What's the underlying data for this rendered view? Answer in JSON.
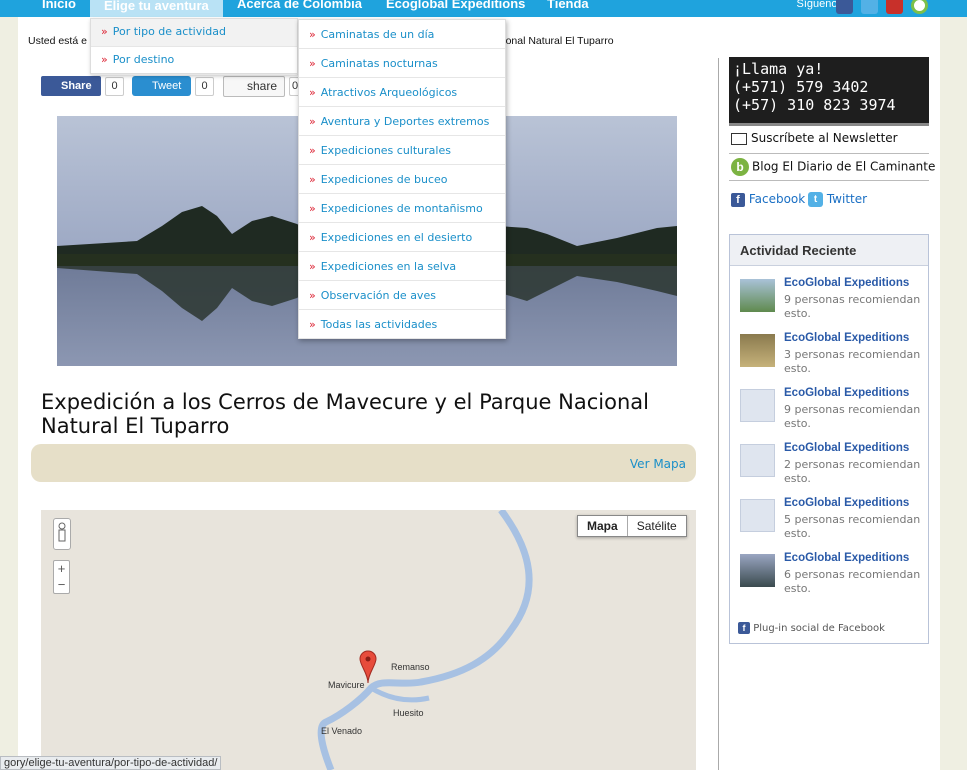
{
  "nav": {
    "items": [
      "Inicio",
      "Elige tu aventura",
      "Acerca de Colombia",
      "Ecoglobal Expeditions",
      "Tienda"
    ],
    "siguenos": "Síguenos"
  },
  "breadcrumb": {
    "start": "Usted está e",
    "end": "cional Natural El Tuparro"
  },
  "submenu1": [
    "Por tipo de actividad",
    "Por destino"
  ],
  "submenu2": [
    "Caminatas de un día",
    "Caminatas nocturnas",
    "Atractivos Arqueológicos",
    "Aventura y Deportes extremos",
    "Expediciones culturales",
    "Expediciones de buceo",
    "Expediciones de montañismo",
    "Expediciones en el desierto",
    "Expediciones en la selva",
    "Observación de aves",
    "Todas las actividades"
  ],
  "share": {
    "fb_label": "Share",
    "fb_count": "0",
    "tweet_label": "Tweet",
    "tweet_count": "0",
    "mail_label": "share",
    "mail_count": "0"
  },
  "page_title": "Expedición a los Cerros de Mavecure y el Parque Nacional Natural El Tuparro",
  "ver_mapa": "Ver Mapa",
  "map": {
    "type_map": "Mapa",
    "type_sat": "Satélite",
    "zoom_in": "+",
    "zoom_out": "−",
    "labels": [
      "Remanso",
      "Mavicure",
      "Huesito",
      "El Venado"
    ]
  },
  "status_url": "gory/elige-tu-aventura/por-tipo-de-actividad/",
  "sidebar": {
    "llama_line1": "¡Llama ya!",
    "llama_line2": "(+571) 579 3402",
    "llama_line3": "(+57) 310 823 3974",
    "newsletter": "Suscríbete al Newsletter",
    "blog": "Blog El Diario de El Caminante",
    "facebook": "Facebook",
    "twitter": "Twitter",
    "activity_title": "Actividad Reciente",
    "activity": [
      {
        "name": "EcoGlobal Expeditions",
        "desc": "9 personas recomiendan esto."
      },
      {
        "name": "EcoGlobal Expeditions",
        "desc": "3 personas recomiendan esto."
      },
      {
        "name": "EcoGlobal Expeditions",
        "desc": "9 personas recomiendan esto."
      },
      {
        "name": "EcoGlobal Expeditions",
        "desc": "2 personas recomiendan esto."
      },
      {
        "name": "EcoGlobal Expeditions",
        "desc": "5 personas recomiendan esto."
      },
      {
        "name": "EcoGlobal Expeditions",
        "desc": "6 personas recomiendan esto."
      }
    ],
    "plugin": "Plug-in social de Facebook"
  }
}
